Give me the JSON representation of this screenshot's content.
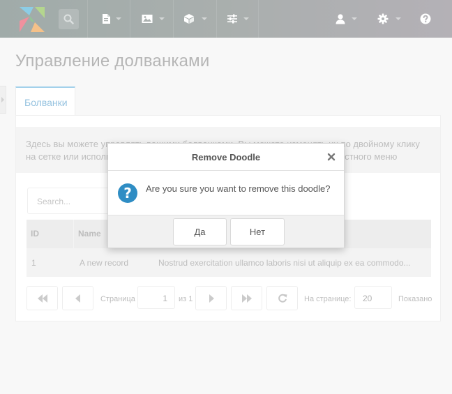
{
  "colors": {
    "accent": "#5ea3cf",
    "question_icon": "#2f8dc4",
    "topbar": "#7c8482"
  },
  "topbar": {
    "icons": [
      "search-icon",
      "file-icon",
      "image-icon",
      "cube-icon",
      "sliders-icon",
      "user-icon",
      "gear-icon",
      "help-icon"
    ]
  },
  "page": {
    "title": "Управление долванками",
    "tab_label": "Болванки",
    "description": "Здесь вы можете управлять вашими болванками. Вы можете изменять их по двойному клику на сетке или используя правую кнопку мыши на объекте для вызова контекстного меню"
  },
  "grid": {
    "search_placeholder": "Search...",
    "columns": [
      "ID",
      "Name"
    ],
    "rows": [
      {
        "id": "1",
        "name": "A new record",
        "description": "Nostrud exercitation ullamco laboris nisi ut aliquip ex ea commodo..."
      }
    ]
  },
  "pager": {
    "page_label": "Страница",
    "page_value": "1",
    "of_label": "из 1",
    "per_page_label": "На странице:",
    "per_page_value": "20",
    "showing_label": "Показано"
  },
  "modal": {
    "title": "Remove Doodle",
    "message": "Are you sure you want to remove this doodle?",
    "yes_label": "Да",
    "no_label": "Нет",
    "icon_glyph": "?"
  }
}
